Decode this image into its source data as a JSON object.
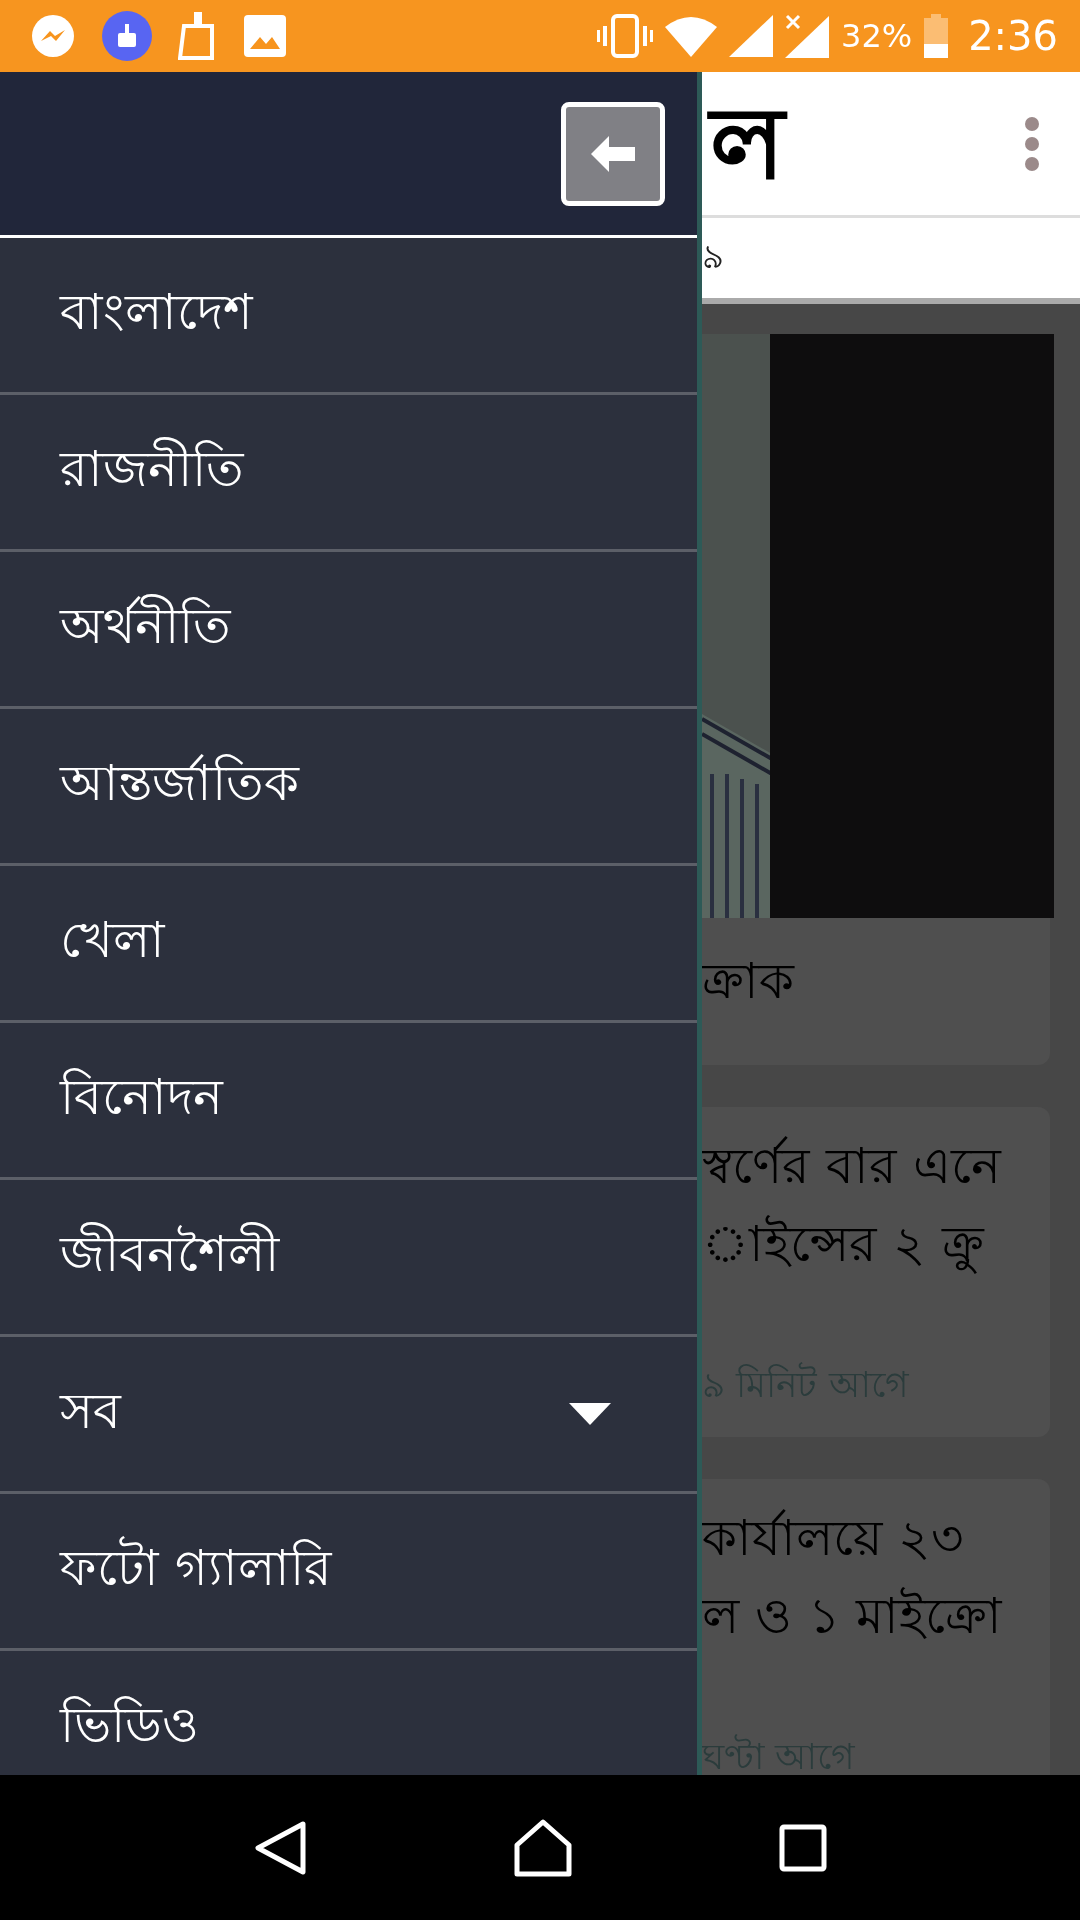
{
  "status_bar": {
    "battery": "32%",
    "time": "2:36"
  },
  "drawer": {
    "items": [
      {
        "label": "বাংলাদেশ",
        "kind": "link"
      },
      {
        "label": "রাজনীতি",
        "kind": "link"
      },
      {
        "label": "অর্থনীতি",
        "kind": "link"
      },
      {
        "label": "আন্তর্জাতিক",
        "kind": "link"
      },
      {
        "label": "খেলা",
        "kind": "link"
      },
      {
        "label": "বিনোদন",
        "kind": "link"
      },
      {
        "label": "জীবনশৈলী",
        "kind": "link"
      },
      {
        "label": "সব",
        "kind": "expandable",
        "expanded": false
      },
      {
        "label": "ফটো গ্যালারি",
        "kind": "link"
      },
      {
        "label": "ভিডিও",
        "kind": "link"
      }
    ]
  },
  "app_bar": {
    "logo": "ল",
    "date": "৯"
  },
  "cards": [
    {
      "kind": "picture",
      "title_lines": [
        "ক্রাক"
      ]
    },
    {
      "kind": "text",
      "title_lines": [
        "স্বর্ণের বার এনে",
        "াইন্সের ২ ক্রু"
      ],
      "time": "৯ মিনিট আগে"
    },
    {
      "kind": "text",
      "title_lines": [
        "কার্যালয়ে ২৩",
        "ল ও ১ মাইক্রো"
      ],
      "time": "ঘণ্টা আগে"
    }
  ]
}
